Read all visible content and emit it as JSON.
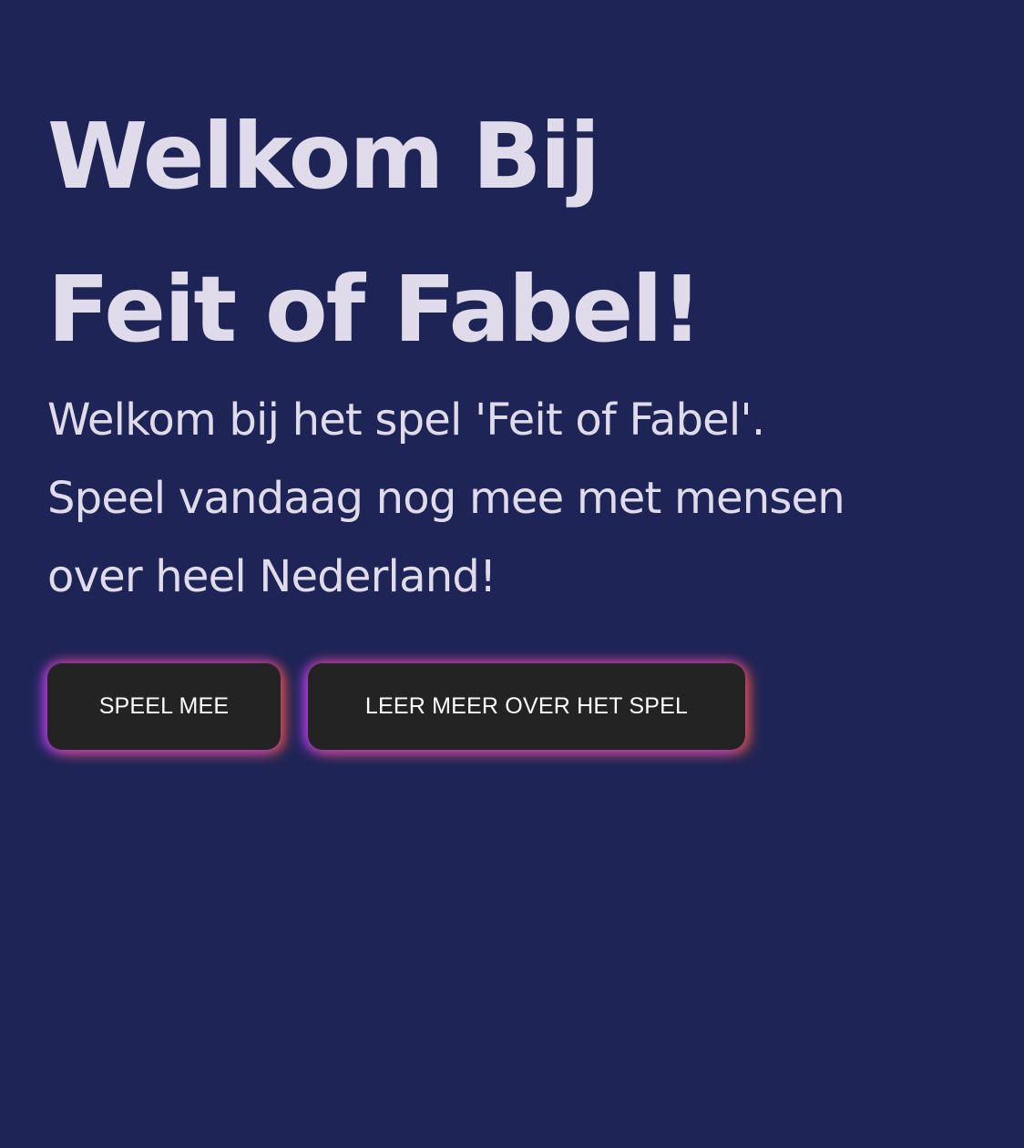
{
  "hero": {
    "title_line_1": "Welkom Bij",
    "title_line_2": "Feit of Fabel!",
    "intro_line_1": "Welkom bij het spel 'Feit of Fabel'.",
    "intro_line_2": "Speel vandaag nog mee met mensen",
    "intro_line_3": "over heel Nederland!"
  },
  "actions": {
    "play_label": "SPEEL MEE",
    "learn_label": "LEER MEER OVER HET SPEL"
  },
  "colors": {
    "background": "#1e2556",
    "text": "#e0dbea",
    "button": "#232323",
    "glow_purple": "#aa3cff",
    "glow_orange": "#ff5f28"
  }
}
